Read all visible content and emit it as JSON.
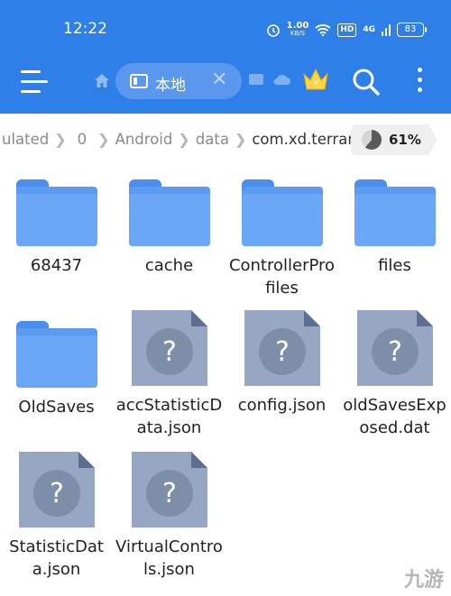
{
  "status_bar": {
    "time": "12:22",
    "net_speed_value": "1.00",
    "net_speed_unit": "KB/S",
    "hd_label": "HD",
    "network_label": "4G",
    "battery": "83"
  },
  "toolbar": {
    "tab_label": "本地"
  },
  "breadcrumb": {
    "items": [
      "ulated",
      "0",
      "Android",
      "data",
      "com.xd.terraria"
    ],
    "storage_percent": "61%"
  },
  "files": [
    {
      "name": "68437",
      "type": "folder"
    },
    {
      "name": "cache",
      "type": "folder"
    },
    {
      "name": "ControllerProfiles",
      "type": "folder"
    },
    {
      "name": "files",
      "type": "folder"
    },
    {
      "name": "OldSaves",
      "type": "folder"
    },
    {
      "name": "accStatisticData.json",
      "type": "file"
    },
    {
      "name": "config.json",
      "type": "file"
    },
    {
      "name": "oldSavesExposed.dat",
      "type": "file"
    },
    {
      "name": "StatisticData.json",
      "type": "file"
    },
    {
      "name": "VirtualControls.json",
      "type": "file"
    }
  ],
  "colors": {
    "accent": "#2f7fe8",
    "folder": "#6aa7f6",
    "unknown_file": "#97a7c3"
  },
  "watermark": "九游"
}
